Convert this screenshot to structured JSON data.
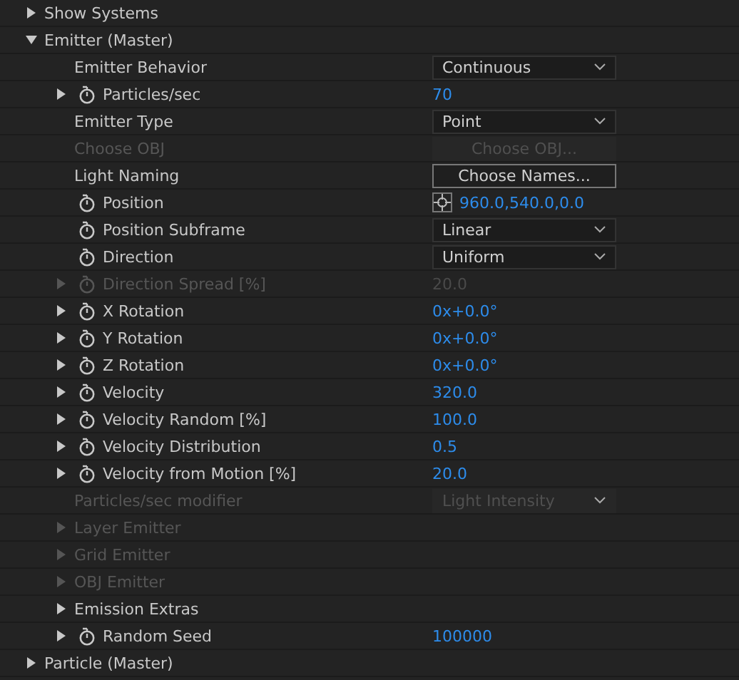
{
  "groups": [
    {
      "label": "Show Systems",
      "expanded": false
    },
    {
      "label": "Emitter (Master)",
      "expanded": true,
      "children": [
        {
          "label": "Emitter Behavior",
          "expandable": false,
          "stopwatch": false,
          "disabled": false,
          "value": {
            "kind": "dropdown",
            "text": "Continuous"
          }
        },
        {
          "label": "Particles/sec",
          "expandable": true,
          "stopwatch": true,
          "disabled": false,
          "value": {
            "kind": "number",
            "text": "70"
          }
        },
        {
          "label": "Emitter Type",
          "expandable": false,
          "stopwatch": false,
          "disabled": false,
          "value": {
            "kind": "dropdown",
            "text": "Point"
          }
        },
        {
          "label": "Choose OBJ",
          "expandable": false,
          "stopwatch": false,
          "disabled": true,
          "value": {
            "kind": "button",
            "text": "Choose OBJ..."
          }
        },
        {
          "label": "Light Naming",
          "expandable": false,
          "stopwatch": false,
          "disabled": false,
          "value": {
            "kind": "button",
            "text": "Choose Names..."
          }
        },
        {
          "label": "Position",
          "expandable": false,
          "stopwatch": true,
          "disabled": false,
          "value": {
            "kind": "point",
            "text": "960.0,540.0,0.0"
          }
        },
        {
          "label": "Position Subframe",
          "expandable": false,
          "stopwatch": true,
          "disabled": false,
          "value": {
            "kind": "dropdown",
            "text": "Linear"
          }
        },
        {
          "label": "Direction",
          "expandable": false,
          "stopwatch": true,
          "disabled": false,
          "value": {
            "kind": "dropdown",
            "text": "Uniform"
          }
        },
        {
          "label": "Direction Spread [%]",
          "expandable": true,
          "stopwatch": true,
          "disabled": true,
          "value": {
            "kind": "number",
            "text": "20.0"
          }
        },
        {
          "label": "X Rotation",
          "expandable": true,
          "stopwatch": true,
          "disabled": false,
          "value": {
            "kind": "number",
            "text": "0x+0.0°"
          }
        },
        {
          "label": "Y Rotation",
          "expandable": true,
          "stopwatch": true,
          "disabled": false,
          "value": {
            "kind": "number",
            "text": "0x+0.0°"
          }
        },
        {
          "label": "Z Rotation",
          "expandable": true,
          "stopwatch": true,
          "disabled": false,
          "value": {
            "kind": "number",
            "text": "0x+0.0°"
          }
        },
        {
          "label": "Velocity",
          "expandable": true,
          "stopwatch": true,
          "disabled": false,
          "value": {
            "kind": "number",
            "text": "320.0"
          }
        },
        {
          "label": "Velocity Random [%]",
          "expandable": true,
          "stopwatch": true,
          "disabled": false,
          "value": {
            "kind": "number",
            "text": "100.0"
          }
        },
        {
          "label": "Velocity Distribution",
          "expandable": true,
          "stopwatch": true,
          "disabled": false,
          "value": {
            "kind": "number",
            "text": "0.5"
          }
        },
        {
          "label": "Velocity from Motion [%]",
          "expandable": true,
          "stopwatch": true,
          "disabled": false,
          "value": {
            "kind": "number",
            "text": "20.0"
          }
        },
        {
          "label": "Particles/sec modifier",
          "expandable": false,
          "stopwatch": false,
          "disabled": true,
          "value": {
            "kind": "dropdown",
            "text": "Light Intensity"
          }
        },
        {
          "label": "Layer Emitter",
          "expandable": true,
          "stopwatch": false,
          "disabled": true
        },
        {
          "label": "Grid Emitter",
          "expandable": true,
          "stopwatch": false,
          "disabled": true
        },
        {
          "label": "OBJ Emitter",
          "expandable": true,
          "stopwatch": false,
          "disabled": true
        },
        {
          "label": "Emission Extras",
          "expandable": true,
          "stopwatch": false,
          "disabled": false
        },
        {
          "label": "Random Seed",
          "expandable": true,
          "stopwatch": true,
          "disabled": false,
          "value": {
            "kind": "number",
            "text": "100000"
          }
        }
      ]
    },
    {
      "label": "Particle (Master)",
      "expanded": false
    }
  ]
}
